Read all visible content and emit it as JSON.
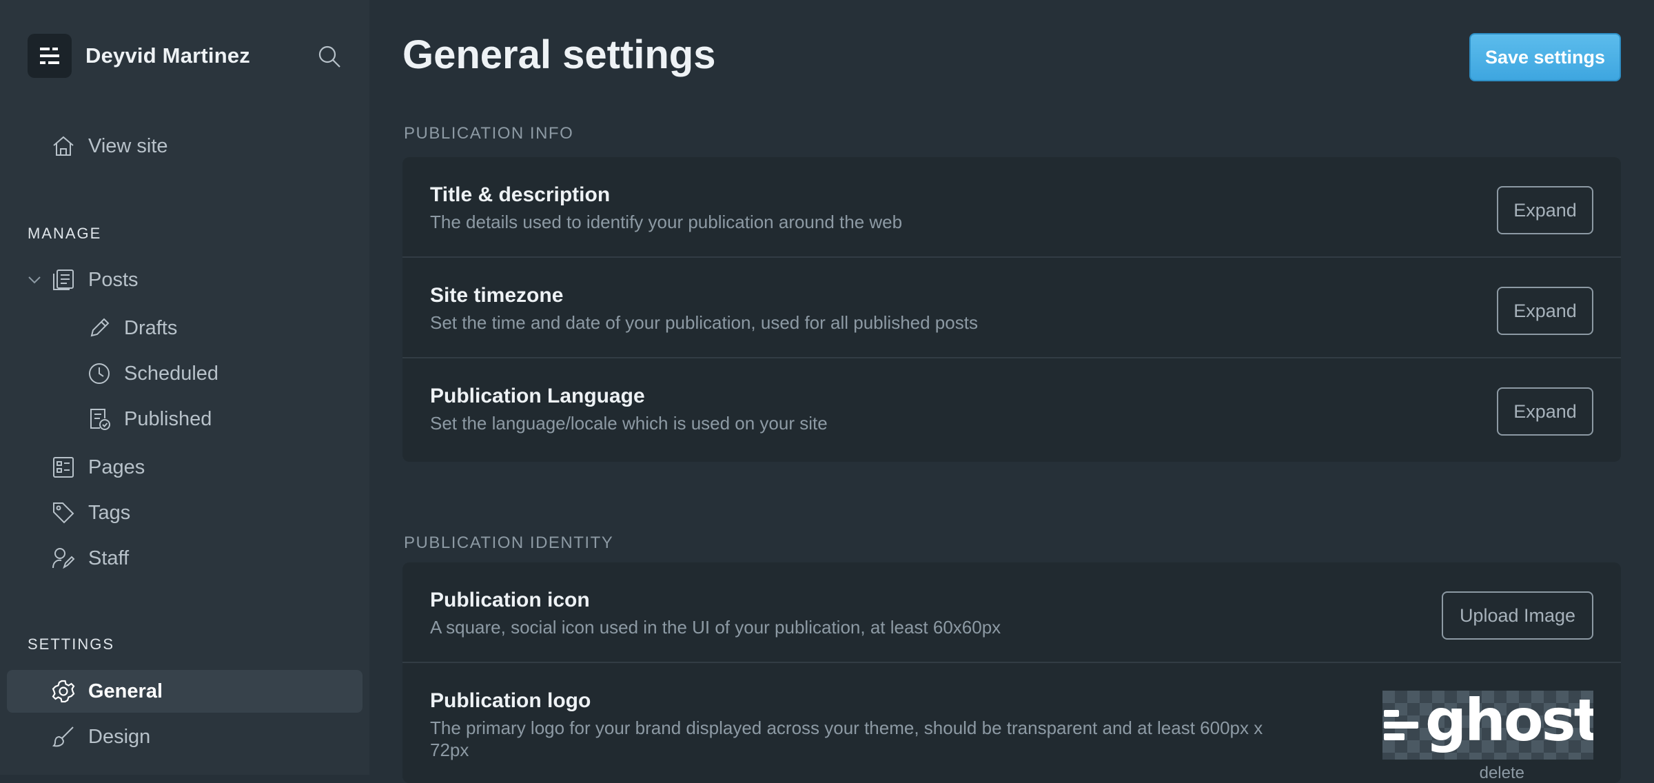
{
  "sidebar": {
    "site_name": "Deyvid Martinez",
    "view_site": "View site",
    "manage_label": "MANAGE",
    "posts": "Posts",
    "drafts": "Drafts",
    "scheduled": "Scheduled",
    "published": "Published",
    "pages": "Pages",
    "tags": "Tags",
    "staff": "Staff",
    "settings_label": "SETTINGS",
    "general": "General",
    "design": "Design"
  },
  "header": {
    "title": "General settings",
    "save_label": "Save settings"
  },
  "publication_info": {
    "label": "PUBLICATION INFO",
    "rows": [
      {
        "title": "Title & description",
        "desc": "The details used to identify your publication around the web",
        "action": "Expand"
      },
      {
        "title": "Site timezone",
        "desc": "Set the time and date of your publication, used for all published posts",
        "action": "Expand"
      },
      {
        "title": "Publication Language",
        "desc": "Set the language/locale which is used on your site",
        "action": "Expand"
      }
    ]
  },
  "publication_identity": {
    "label": "PUBLICATION IDENTITY",
    "icon_row": {
      "title": "Publication icon",
      "desc": "A square, social icon used in the UI of your publication, at least 60x60px",
      "action": "Upload Image"
    },
    "logo_row": {
      "title": "Publication logo",
      "desc": "The primary logo for your brand displayed across your theme, should be transparent and at least 600px x 72px",
      "logo_text": "ghost",
      "delete_label": "delete"
    }
  },
  "colors": {
    "sidebar_bg": "#2b353d",
    "main_bg": "#263038",
    "card_bg": "#212a30",
    "accent": "#4cb2e6"
  }
}
